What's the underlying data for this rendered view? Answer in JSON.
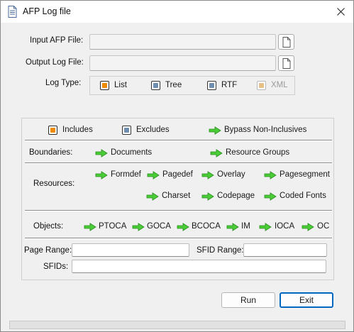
{
  "window": {
    "title": "AFP Log file",
    "close_glyph": "✕",
    "title_icon": "document-icon"
  },
  "files": {
    "input_label": "Input AFP File:",
    "input_value": "",
    "output_label": "Output Log File:",
    "output_value": ""
  },
  "log_type": {
    "label": "Log Type:",
    "options": [
      {
        "label": "List",
        "checked": true
      },
      {
        "label": "Tree",
        "checked": false
      },
      {
        "label": "RTF",
        "checked": false
      },
      {
        "label": "XML",
        "checked": false,
        "disabled": true
      }
    ]
  },
  "filters": {
    "includes": "Includes",
    "excludes": "Excludes",
    "bypass": "Bypass Non-Inclusives"
  },
  "boundaries": {
    "label": "Boundaries:",
    "items": [
      "Documents",
      "Resource Groups"
    ]
  },
  "resources": {
    "label": "Resources:",
    "row1": [
      "Formdef",
      "Pagedef",
      "Overlay",
      "Pagesegment"
    ],
    "row2": [
      "Charset",
      "Codepage",
      "Coded Fonts"
    ]
  },
  "objects": {
    "label": "Objects:",
    "items": [
      "PTOCA",
      "GOCA",
      "BCOCA",
      "IM",
      "IOCA",
      "OC"
    ]
  },
  "ranges": {
    "page_range_label": "Page Range:",
    "page_range_value": "",
    "sfid_range_label": "SFID Range:",
    "sfid_range_value": "",
    "sfids_label": "SFIDs:",
    "sfids_value": ""
  },
  "buttons": {
    "run": "Run",
    "exit": "Exit"
  },
  "colors": {
    "checked_fill": "#f08a00",
    "unchecked_fill": "#6f8fb0",
    "arrow_green": "#3dc42f"
  }
}
